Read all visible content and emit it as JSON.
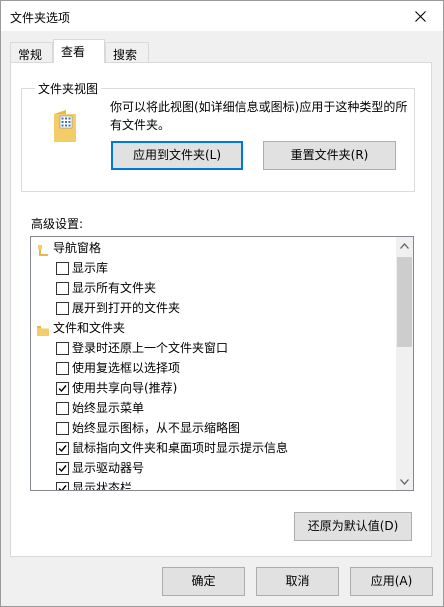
{
  "window": {
    "title": "文件夹选项"
  },
  "tabs": [
    {
      "label": "常规"
    },
    {
      "label": "查看"
    },
    {
      "label": "搜索"
    }
  ],
  "folder_views": {
    "title": "文件夹视图",
    "description": "你可以将此视图(如详细信息或图标)应用于这种类型的所有文件夹。",
    "apply_button": "应用到文件夹(L)",
    "reset_button": "重置文件夹(R)"
  },
  "advanced": {
    "label": "高级设置:",
    "items": [
      {
        "type": "category",
        "label": "导航窗格",
        "icon": "navigation-pane-icon"
      },
      {
        "type": "checkbox",
        "label": "显示库",
        "checked": false
      },
      {
        "type": "checkbox",
        "label": "显示所有文件夹",
        "checked": false
      },
      {
        "type": "checkbox",
        "label": "展开到打开的文件夹",
        "checked": false
      },
      {
        "type": "category",
        "label": "文件和文件夹",
        "icon": "folder-icon"
      },
      {
        "type": "checkbox",
        "label": "登录时还原上一个文件夹窗口",
        "checked": false
      },
      {
        "type": "checkbox",
        "label": "使用复选框以选择项",
        "checked": false
      },
      {
        "type": "checkbox",
        "label": "使用共享向导(推荐)",
        "checked": true
      },
      {
        "type": "checkbox",
        "label": "始终显示菜单",
        "checked": false
      },
      {
        "type": "checkbox",
        "label": "始终显示图标，从不显示缩略图",
        "checked": false
      },
      {
        "type": "checkbox",
        "label": "鼠标指向文件夹和桌面项时显示提示信息",
        "checked": true
      },
      {
        "type": "checkbox",
        "label": "显示驱动器号",
        "checked": true
      },
      {
        "type": "checkbox",
        "label": "显示状态栏",
        "checked": true
      }
    ],
    "restore_button": "还原为默认值(D)"
  },
  "footer": {
    "ok": "确定",
    "cancel": "取消",
    "apply": "应用(A)"
  },
  "colors": {
    "accent": "#0078d7",
    "folder": "#f3cd68"
  }
}
